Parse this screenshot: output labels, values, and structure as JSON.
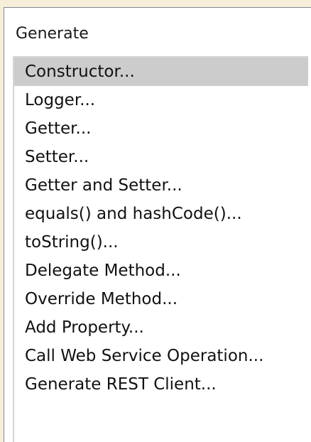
{
  "dialog": {
    "title": "Generate"
  },
  "menu": {
    "selected_index": 0,
    "items": [
      {
        "label": "Constructor..."
      },
      {
        "label": "Logger..."
      },
      {
        "label": "Getter..."
      },
      {
        "label": "Setter..."
      },
      {
        "label": "Getter and Setter..."
      },
      {
        "label": "equals() and hashCode()..."
      },
      {
        "label": "toString()..."
      },
      {
        "label": "Delegate Method..."
      },
      {
        "label": "Override Method..."
      },
      {
        "label": "Add Property..."
      },
      {
        "label": "Call Web Service Operation..."
      },
      {
        "label": "Generate REST Client..."
      }
    ]
  },
  "colors": {
    "background": "#f7eeda",
    "popup_background": "#ffffff",
    "selection": "#cccccc",
    "text": "#111111"
  }
}
